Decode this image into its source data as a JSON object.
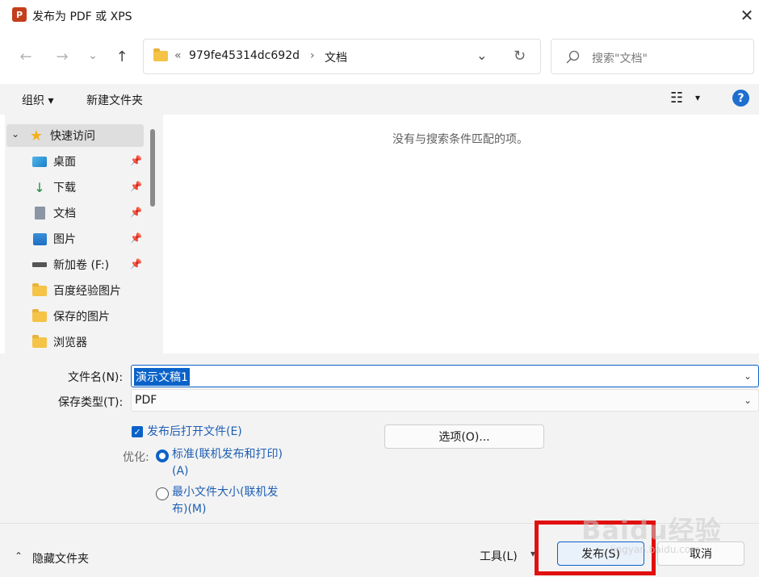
{
  "window": {
    "title": "发布为 PDF 或 XPS",
    "app_icon": "P",
    "close": "✕"
  },
  "nav": {
    "back": "←",
    "forward": "→",
    "recent": "⌄",
    "up": "↑"
  },
  "address": {
    "prefix": "«",
    "folder": "979fe45314dc692d",
    "sep": "›",
    "current": "文档",
    "dropdown": "⌄",
    "refresh": "↻"
  },
  "search": {
    "placeholder": "搜索\"文档\""
  },
  "toolbar": {
    "organize": "组织 ▾",
    "new_folder": "新建文件夹",
    "view": "☷",
    "view_arrow": "▾",
    "help": "?"
  },
  "sidebar": {
    "quick_access": "快速访问",
    "items": [
      {
        "label": "桌面",
        "icon": "desktop-icon",
        "pinned": true
      },
      {
        "label": "下载",
        "icon": "download-icon",
        "pinned": true
      },
      {
        "label": "文档",
        "icon": "document-icon",
        "pinned": true
      },
      {
        "label": "图片",
        "icon": "pictures-icon",
        "pinned": true
      },
      {
        "label": "新加卷 (F:)",
        "icon": "drive-icon",
        "pinned": true
      },
      {
        "label": "百度经验图片",
        "icon": "folder-icon",
        "pinned": false
      },
      {
        "label": "保存的图片",
        "icon": "folder-icon",
        "pinned": false
      },
      {
        "label": "浏览器",
        "icon": "folder-icon",
        "pinned": false
      }
    ]
  },
  "content": {
    "empty_message": "没有与搜索条件匹配的项。"
  },
  "form": {
    "filename_label": "文件名(N):",
    "filename_value": "演示文稿1",
    "type_label": "保存类型(T):",
    "type_value": "PDF",
    "open_after": "发布后打开文件(E)",
    "options_button": "选项(O)...",
    "optimize_label": "优化:",
    "opt_standard_1": "标准(联机发布和打印)",
    "opt_standard_2": "(A)",
    "opt_min_1": "最小文件大小(联机发",
    "opt_min_2": "布)(M)"
  },
  "footer": {
    "hide_folders": "隐藏文件夹",
    "tools": "工具(L)",
    "publish": "发布(S)",
    "cancel": "取消"
  },
  "watermark": {
    "text": "Baidu经验",
    "url": "jingyan.baidu.com"
  },
  "colors": {
    "accent": "#0a62c9",
    "highlight_box": "#e11010"
  }
}
